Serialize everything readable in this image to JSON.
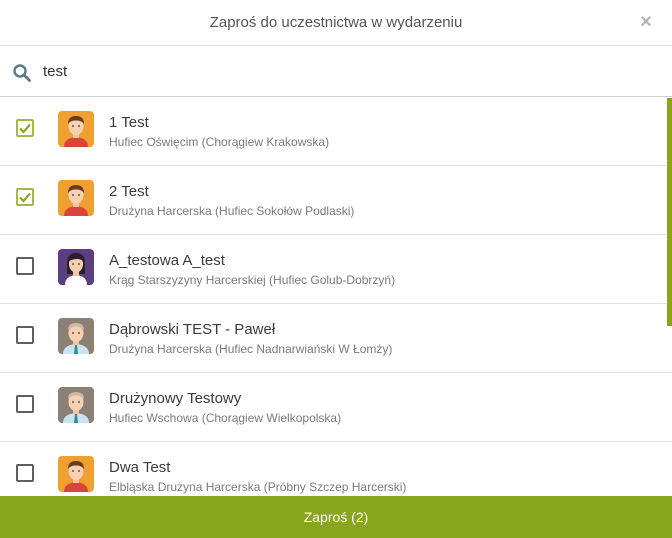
{
  "dialog": {
    "title": "Zaproś do uczestnictwa w wydarzeniu"
  },
  "search": {
    "value": "test",
    "icon": "search-icon"
  },
  "colors": {
    "accent": "#88a51c"
  },
  "people": [
    {
      "name": "1 Test",
      "unit": "Hufiec Oświęcim (Chorągiew Krakowska)",
      "checked": true,
      "avatar": "boy"
    },
    {
      "name": "2 Test",
      "unit": "Drużyna Harcerska (Hufiec Sokołów Podlaski)",
      "checked": true,
      "avatar": "boy"
    },
    {
      "name": "A_testowa A_test",
      "unit": "Krąg Starszyzyny Harcerskiej (Hufiec Golub-Dobrzyń)",
      "checked": false,
      "avatar": "girl"
    },
    {
      "name": "Dąbrowski TEST - Paweł",
      "unit": "Drużyna Harcerska (Hufiec Nadnarwiański W Łomży)",
      "checked": false,
      "avatar": "man"
    },
    {
      "name": "Drużynowy Testowy",
      "unit": "Hufiec Wschowa (Chorągiew Wielkopolska)",
      "checked": false,
      "avatar": "man"
    },
    {
      "name": "Dwa Test",
      "unit": "Elbląska Drużyna Harcerska (Próbny Szczep Harcerski)",
      "checked": false,
      "avatar": "boy"
    }
  ],
  "footer": {
    "label": "Zaproś (2)"
  }
}
